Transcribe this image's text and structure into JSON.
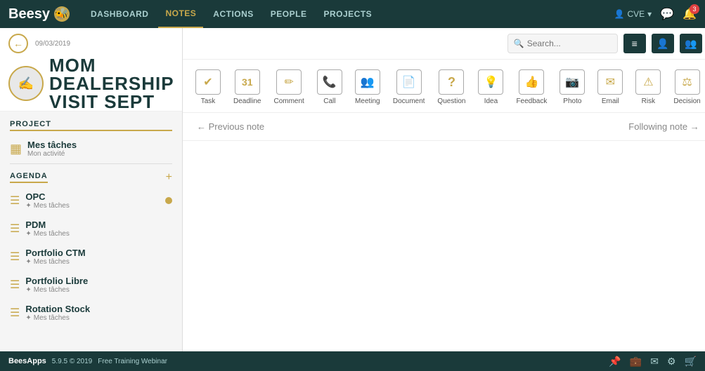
{
  "app": {
    "logo": "Beesy",
    "logo_icon": "🐝"
  },
  "nav": {
    "links": [
      {
        "label": "DASHBOARD",
        "active": false
      },
      {
        "label": "NOTES",
        "active": true
      },
      {
        "label": "ACTIONS",
        "active": false
      },
      {
        "label": "PEOPLE",
        "active": false
      },
      {
        "label": "PROJECTS",
        "active": false
      }
    ],
    "user_label": "CVE",
    "notification_badge": "3"
  },
  "note": {
    "date": "09/03/2019",
    "title": "MOM DEALERSHIP VISIT SEPT",
    "avatar_icon": "✍",
    "search_placeholder": "Search..."
  },
  "note_types": [
    {
      "label": "Task",
      "icon": "✓",
      "unicode": "✔"
    },
    {
      "label": "Deadline",
      "icon": "31"
    },
    {
      "label": "Comment",
      "icon": "✏"
    },
    {
      "label": "Call",
      "icon": "📞"
    },
    {
      "label": "Meeting",
      "icon": "👥"
    },
    {
      "label": "Document",
      "icon": "📄"
    },
    {
      "label": "Question",
      "icon": "?"
    },
    {
      "label": "Idea",
      "icon": "💡"
    },
    {
      "label": "Feedback",
      "icon": "👥"
    },
    {
      "label": "Photo",
      "icon": "📷"
    },
    {
      "label": "Email",
      "icon": "✉"
    },
    {
      "label": "Risk",
      "icon": "⚠"
    },
    {
      "label": "Decision",
      "icon": "⚖"
    }
  ],
  "navigation": {
    "prev": "← Previous note",
    "next": "Following note →"
  },
  "sidebar": {
    "project_section": "PROJECT",
    "project_name": "Mes tâches",
    "project_sub": "Mon activité",
    "agenda_section": "AGENDA",
    "items": [
      {
        "name": "OPC",
        "sub": "Mes tâches",
        "dot": true
      },
      {
        "name": "PDM",
        "sub": "Mes tâches",
        "dot": false
      },
      {
        "name": "Portfolio CTM",
        "sub": "Mes tâches",
        "dot": false
      },
      {
        "name": "Portfolio Libre",
        "sub": "Mes tâches",
        "dot": false
      },
      {
        "name": "Rotation Stock",
        "sub": "Mes tâches",
        "dot": false
      }
    ]
  },
  "footer": {
    "logo": "BeesApps",
    "version": "5.9.5 © 2019",
    "training": "Free Training Webinar"
  }
}
